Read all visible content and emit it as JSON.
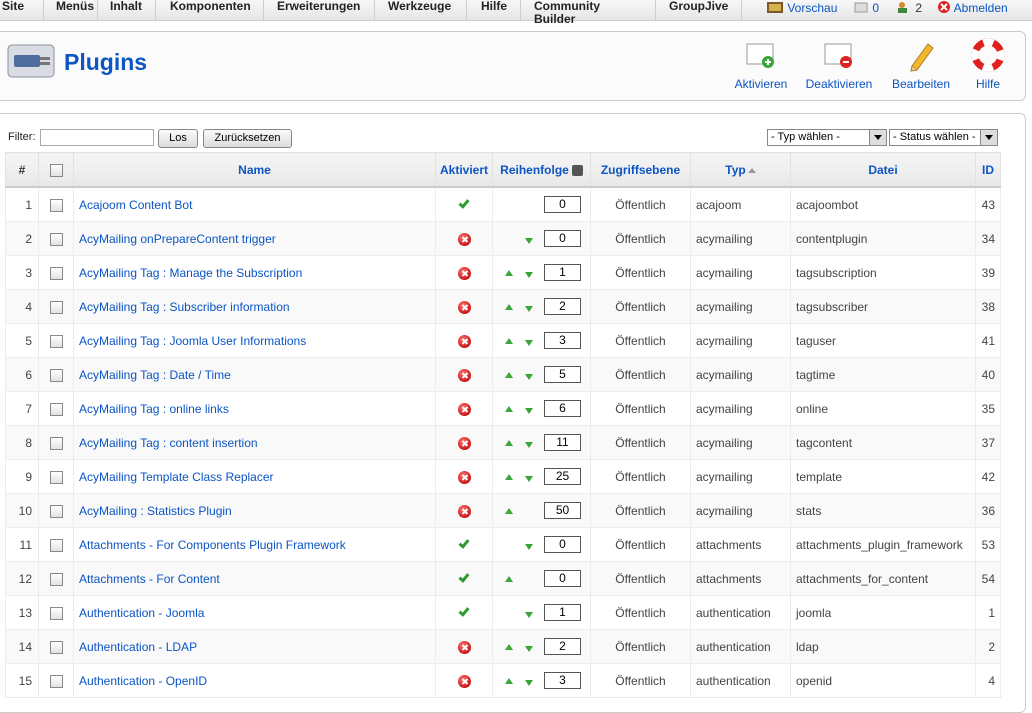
{
  "menu": [
    "Site",
    "Menüs",
    "Inhalt",
    "Komponenten",
    "Erweiterungen",
    "Werkzeuge",
    "Hilfe",
    "Community Builder",
    "GroupJive"
  ],
  "status": {
    "preview": "Vorschau",
    "messages": "0",
    "users": "2",
    "logout": "Abmelden"
  },
  "page": {
    "title": "Plugins"
  },
  "toolbar": {
    "activate": "Aktivieren",
    "deactivate": "Deaktivieren",
    "edit": "Bearbeiten",
    "help": "Hilfe"
  },
  "filter": {
    "label": "Filter:",
    "value": "",
    "go": "Los",
    "reset": "Zurücksetzen",
    "type_select": "- Typ wählen -",
    "status_select": "- Status wählen -"
  },
  "columns": {
    "num": "#",
    "name": "Name",
    "active": "Aktiviert",
    "order": "Reihenfolge",
    "access": "Zugriffsebene",
    "type": "Typ",
    "file": "Datei",
    "id": "ID"
  },
  "rows": [
    {
      "n": "1",
      "name": "Acajoom Content Bot",
      "active": true,
      "up": false,
      "down": false,
      "order": "0",
      "access": "Öffentlich",
      "type": "acajoom",
      "file": "acajoombot",
      "id": "43"
    },
    {
      "n": "2",
      "name": "AcyMailing onPrepareContent trigger",
      "active": false,
      "up": false,
      "down": true,
      "order": "0",
      "access": "Öffentlich",
      "type": "acymailing",
      "file": "contentplugin",
      "id": "34"
    },
    {
      "n": "3",
      "name": "AcyMailing Tag : Manage the Subscription",
      "active": false,
      "up": true,
      "down": true,
      "order": "1",
      "access": "Öffentlich",
      "type": "acymailing",
      "file": "tagsubscription",
      "id": "39"
    },
    {
      "n": "4",
      "name": "AcyMailing Tag : Subscriber information",
      "active": false,
      "up": true,
      "down": true,
      "order": "2",
      "access": "Öffentlich",
      "type": "acymailing",
      "file": "tagsubscriber",
      "id": "38"
    },
    {
      "n": "5",
      "name": "AcyMailing Tag : Joomla User Informations",
      "active": false,
      "up": true,
      "down": true,
      "order": "3",
      "access": "Öffentlich",
      "type": "acymailing",
      "file": "taguser",
      "id": "41"
    },
    {
      "n": "6",
      "name": "AcyMailing Tag : Date / Time",
      "active": false,
      "up": true,
      "down": true,
      "order": "5",
      "access": "Öffentlich",
      "type": "acymailing",
      "file": "tagtime",
      "id": "40"
    },
    {
      "n": "7",
      "name": "AcyMailing Tag : online links",
      "active": false,
      "up": true,
      "down": true,
      "order": "6",
      "access": "Öffentlich",
      "type": "acymailing",
      "file": "online",
      "id": "35"
    },
    {
      "n": "8",
      "name": "AcyMailing Tag : content insertion",
      "active": false,
      "up": true,
      "down": true,
      "order": "11",
      "access": "Öffentlich",
      "type": "acymailing",
      "file": "tagcontent",
      "id": "37"
    },
    {
      "n": "9",
      "name": "AcyMailing Template Class Replacer",
      "active": false,
      "up": true,
      "down": true,
      "order": "25",
      "access": "Öffentlich",
      "type": "acymailing",
      "file": "template",
      "id": "42"
    },
    {
      "n": "10",
      "name": "AcyMailing : Statistics Plugin",
      "active": false,
      "up": true,
      "down": false,
      "order": "50",
      "access": "Öffentlich",
      "type": "acymailing",
      "file": "stats",
      "id": "36"
    },
    {
      "n": "11",
      "name": "Attachments - For Components Plugin Framework",
      "active": true,
      "up": false,
      "down": true,
      "order": "0",
      "access": "Öffentlich",
      "type": "attachments",
      "file": "attachments_plugin_framework",
      "id": "53"
    },
    {
      "n": "12",
      "name": "Attachments - For Content",
      "active": true,
      "up": true,
      "down": false,
      "order": "0",
      "access": "Öffentlich",
      "type": "attachments",
      "file": "attachments_for_content",
      "id": "54"
    },
    {
      "n": "13",
      "name": "Authentication - Joomla",
      "active": true,
      "up": false,
      "down": true,
      "order": "1",
      "access": "Öffentlich",
      "type": "authentication",
      "file": "joomla",
      "id": "1"
    },
    {
      "n": "14",
      "name": "Authentication - LDAP",
      "active": false,
      "up": true,
      "down": true,
      "order": "2",
      "access": "Öffentlich",
      "type": "authentication",
      "file": "ldap",
      "id": "2"
    },
    {
      "n": "15",
      "name": "Authentication - OpenID",
      "active": false,
      "up": true,
      "down": true,
      "order": "3",
      "access": "Öffentlich",
      "type": "authentication",
      "file": "openid",
      "id": "4"
    }
  ]
}
